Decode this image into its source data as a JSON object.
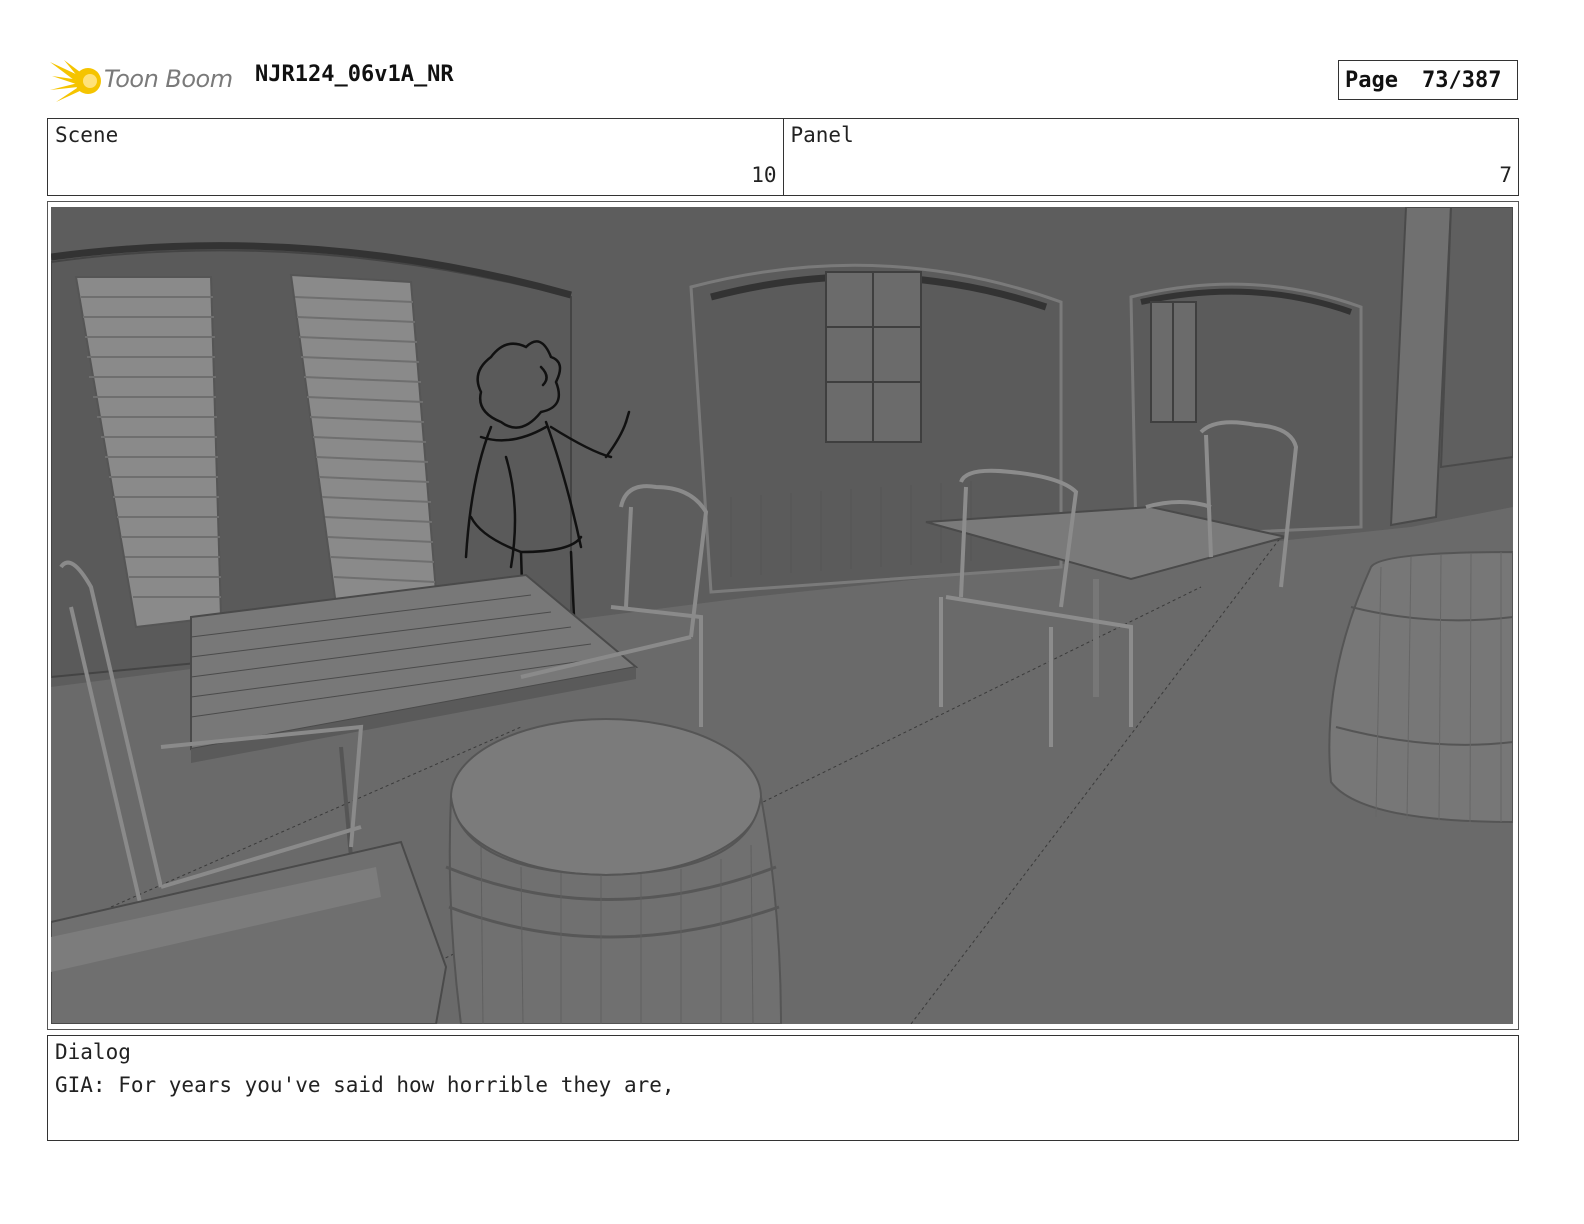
{
  "header": {
    "logo_text": "Toon Boom",
    "document_title": "NJR124_06v1A_NR",
    "page_label": "Page",
    "page_number": "73/387"
  },
  "info": {
    "scene_label": "Scene",
    "scene_value": "10",
    "panel_label": "Panel",
    "panel_value": "7"
  },
  "panel_image": {
    "background_color": "#666666"
  },
  "dialog": {
    "label": "Dialog",
    "text": "GIA: For years you've said how horrible they are,"
  },
  "colors": {
    "logo_accent": "#f5c400",
    "border": "#333333"
  }
}
